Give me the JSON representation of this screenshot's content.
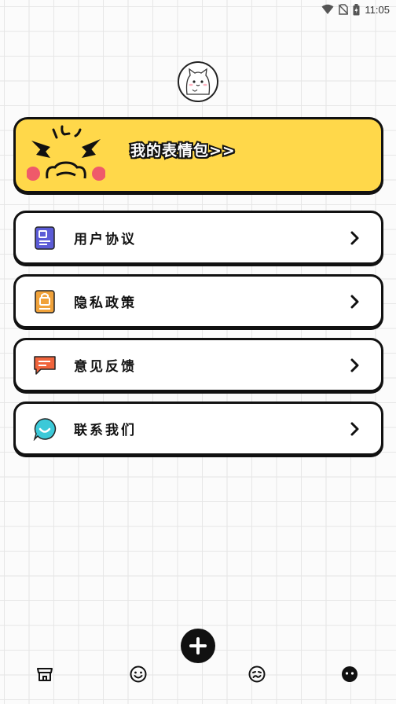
{
  "status_bar": {
    "time": "11:05",
    "icons": [
      "wifi-icon",
      "no-sim-icon",
      "battery-charging-icon"
    ]
  },
  "profile": {
    "avatar_icon": "cat-avatar-icon"
  },
  "banner": {
    "title": "我的表情包>>",
    "icon": "angry-face-icon",
    "background_color": "#ffd84a"
  },
  "menu": {
    "items": [
      {
        "label": "用户协议",
        "icon": "document-icon",
        "icon_color": "#5b5bd6"
      },
      {
        "label": "隐私政策",
        "icon": "lock-document-icon",
        "icon_color": "#f0a23a"
      },
      {
        "label": "意见反馈",
        "icon": "message-icon",
        "icon_color": "#f0643c"
      },
      {
        "label": "联系我们",
        "icon": "chat-bubble-icon",
        "icon_color": "#3cc9d8"
      }
    ]
  },
  "fab": {
    "icon": "plus-icon"
  },
  "tabbar": {
    "tabs": [
      {
        "icon": "store-icon"
      },
      {
        "icon": "smile-icon"
      },
      {
        "icon": "meh-face-icon"
      },
      {
        "icon": "profile-face-icon",
        "active": true
      }
    ]
  }
}
